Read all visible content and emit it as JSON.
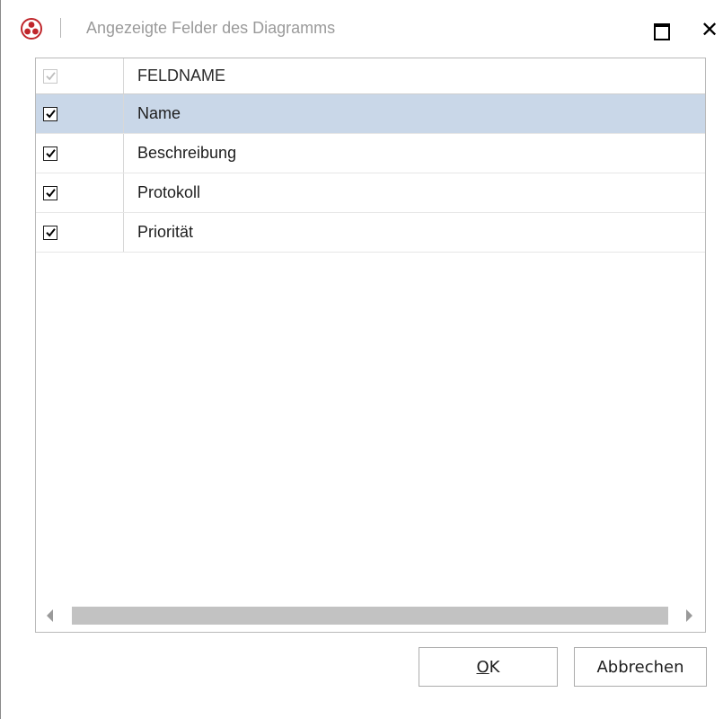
{
  "window": {
    "title": "Angezeigte Felder des Diagramms",
    "icons": {
      "app": "app-logo-icon",
      "maximize": "maximize-icon",
      "close": "close-icon"
    },
    "close_glyph": "✕"
  },
  "grid": {
    "header": {
      "label": "FELDNAME",
      "check_all_checked": true
    },
    "rows": [
      {
        "label": "Name",
        "checked": true,
        "selected": true
      },
      {
        "label": "Beschreibung",
        "checked": true,
        "selected": false
      },
      {
        "label": "Protokoll",
        "checked": true,
        "selected": false
      },
      {
        "label": "Priorität",
        "checked": true,
        "selected": false
      }
    ],
    "selection_color": "#c9d7e8"
  },
  "buttons": {
    "ok_mnemonic": "O",
    "ok_rest": "K",
    "cancel": "Abbrechen"
  }
}
